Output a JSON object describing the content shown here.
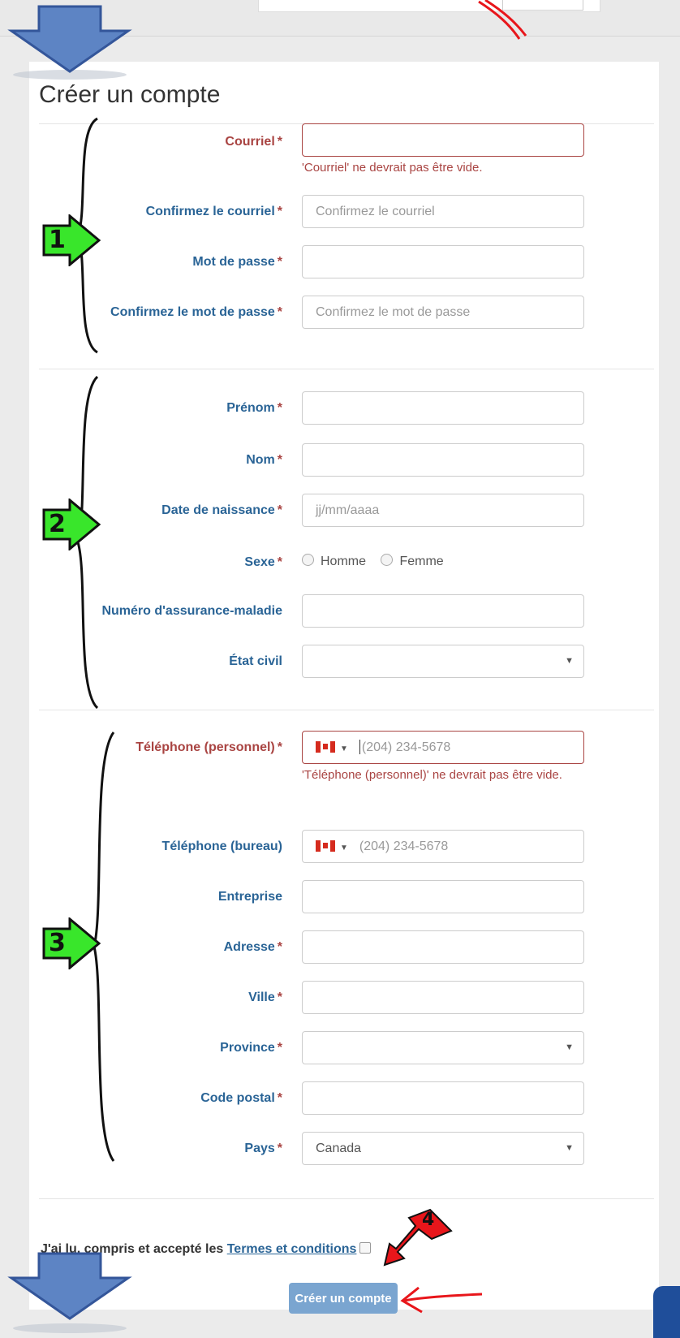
{
  "form": {
    "title": "Créer un compte",
    "required_marker": "*",
    "section1": {
      "email_label": "Courriel",
      "email_value": "",
      "email_error": "'Courriel' ne devrait pas être vide.",
      "confirm_email_label": "Confirmez le courriel",
      "confirm_email_placeholder": "Confirmez le courriel",
      "password_label": "Mot de passe",
      "confirm_password_label": "Confirmez le mot de passe",
      "confirm_password_placeholder": "Confirmez le mot de passe"
    },
    "section2": {
      "first_name_label": "Prénom",
      "last_name_label": "Nom",
      "birthdate_label": "Date de naissance",
      "birthdate_placeholder": "jj/mm/aaaa",
      "sex_label": "Sexe",
      "sex_options": [
        "Homme",
        "Femme"
      ],
      "health_number_label": "Numéro d'assurance-maladie",
      "marital_status_label": "État civil",
      "marital_status_value": ""
    },
    "section3": {
      "phone_personal_label": "Téléphone (personnel)",
      "phone_personal_placeholder": "(204) 234-5678",
      "phone_personal_error": "'Téléphone (personnel)' ne devrait pas être vide.",
      "phone_work_label": "Téléphone (bureau)",
      "phone_work_placeholder": "(204) 234-5678",
      "company_label": "Entreprise",
      "address_label": "Adresse",
      "city_label": "Ville",
      "province_label": "Province",
      "province_value": "",
      "postal_code_label": "Code postal",
      "country_label": "Pays",
      "country_value": "Canada"
    },
    "terms_prefix": "J'ai lu, compris et accepté les",
    "terms_link": "Termes et conditions",
    "submit_label": "Créer un compte"
  },
  "annotations": {
    "step_1": "1",
    "step_2": "2",
    "step_3": "3",
    "step_4": "4"
  },
  "colors": {
    "label_blue": "#2a6496",
    "error_red": "#a94442",
    "button_blue": "#7aa5d0",
    "annotation_green": "#39e62b",
    "annotation_red": "#e8161b"
  }
}
